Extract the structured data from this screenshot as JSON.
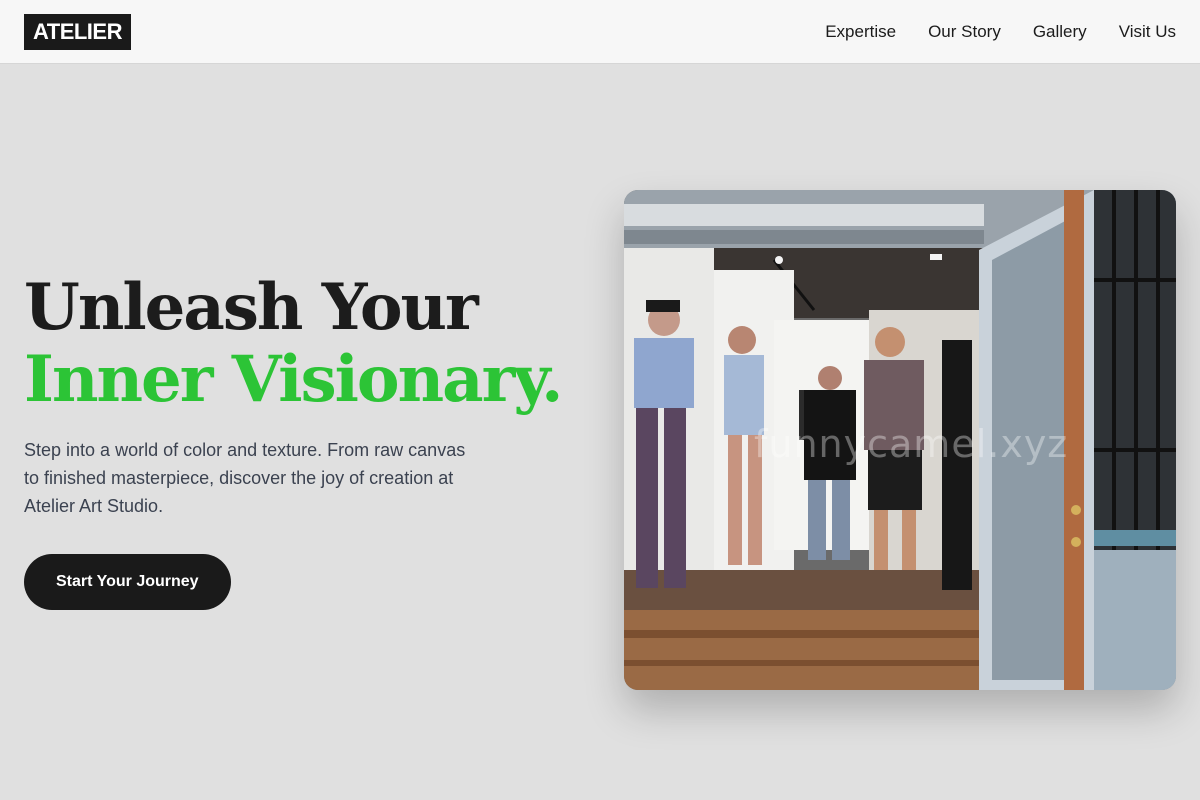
{
  "brand": {
    "logo_text": "ATELIER"
  },
  "nav": {
    "items": [
      {
        "label": "Expertise"
      },
      {
        "label": "Our Story"
      },
      {
        "label": "Gallery"
      },
      {
        "label": "Visit Us"
      }
    ]
  },
  "hero": {
    "headline_line1": "Unleash Your",
    "headline_line2": "Inner Visionary.",
    "description": "Step into a world of color and texture. From raw canvas to finished masterpiece, discover the joy of creation at Atelier Art Studio.",
    "cta_label": "Start Your Journey"
  },
  "photo": {
    "watermark": "funnycamel.xyz"
  },
  "colors": {
    "accent_green": "#2cc436",
    "dark": "#1a1a1a",
    "background": "#e0e0e0",
    "topbar": "#f7f7f7"
  }
}
